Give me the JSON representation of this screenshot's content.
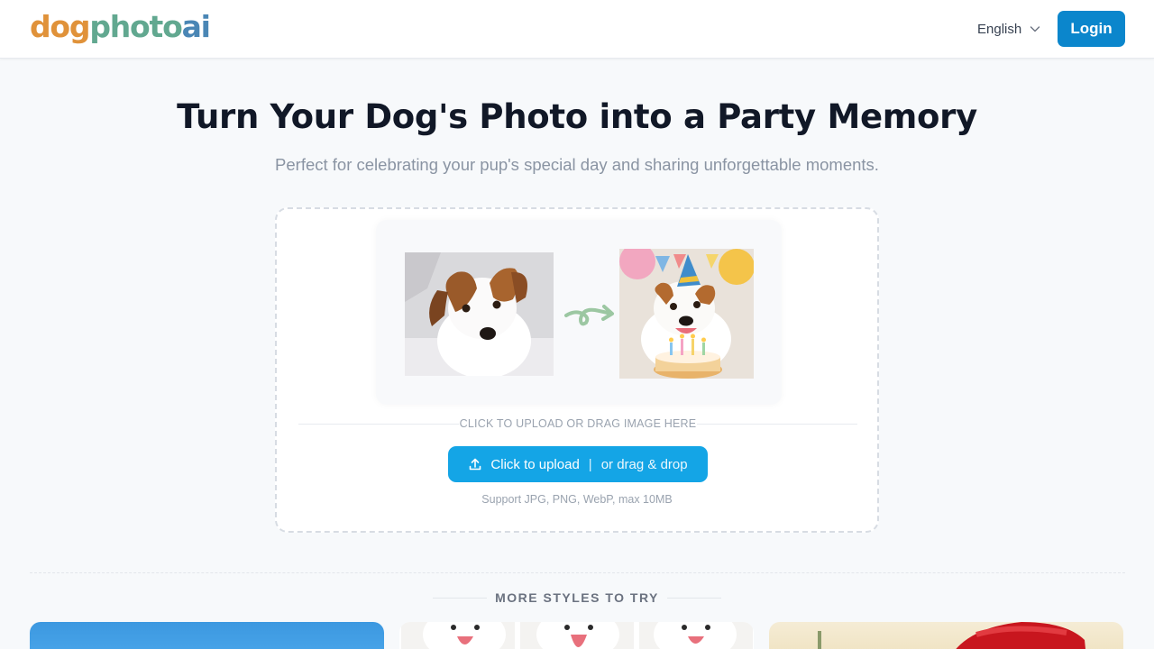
{
  "header": {
    "logo": {
      "part1": "dog",
      "part2": "photo",
      "part3": "ai"
    },
    "language": {
      "selected": "English",
      "icon": "chevron-down-icon"
    },
    "login_label": "Login"
  },
  "hero": {
    "title": "Turn Your Dog's Photo into a Party Memory",
    "subtitle": "Perfect for celebrating your pup's special day and sharing unforgettable moments."
  },
  "upload": {
    "preview": {
      "before_image": "jack-russell-puppy-photo",
      "arrow_icon": "swirl-arrow-icon",
      "after_image": "jack-russell-birthday-party-photo"
    },
    "divider_label": "CLICK TO UPLOAD OR DRAG IMAGE HERE",
    "button": {
      "icon": "upload-icon",
      "primary": "Click to upload",
      "separator": "|",
      "secondary": "or drag & drop"
    },
    "support_text": "Support JPG, PNG, WebP, max 10MB"
  },
  "more_styles": {
    "title": "MORE STYLES TO TRY",
    "cards": [
      {
        "image": "blue-sky-style-thumbnail"
      },
      {
        "image": "white-puppies-style-thumbnail"
      },
      {
        "image": "santa-hat-style-thumbnail"
      }
    ]
  },
  "colors": {
    "primary": "#0b86cc",
    "upload_button": "#14a5e6",
    "logo_orange": "#e0923a",
    "logo_green": "#62a890",
    "logo_blue": "#4a86b5",
    "page_background": "#f7f9fb"
  }
}
